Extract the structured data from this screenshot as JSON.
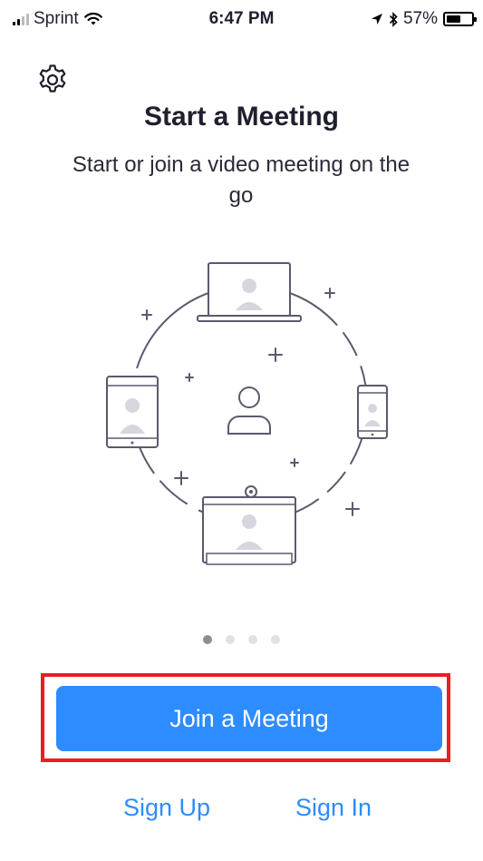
{
  "status_bar": {
    "carrier": "Sprint",
    "time": "6:47 PM",
    "battery": "57%",
    "battery_level": 0.57,
    "icons": [
      "signal-icon",
      "wifi-icon",
      "location-arrow-icon",
      "bluetooth-icon",
      "battery-icon"
    ]
  },
  "header": {
    "settings_icon": "gear-icon"
  },
  "main": {
    "title": "Start a Meeting",
    "subtitle": "Start or join a video meeting on the go",
    "illustration_icons": [
      "laptop-icon",
      "tablet-icon",
      "phone-icon",
      "room-display-icon",
      "user-icon",
      "plus-icon"
    ],
    "page_indicator": {
      "count": 4,
      "active_index": 0
    }
  },
  "actions": {
    "join_label": "Join a Meeting",
    "signup_label": "Sign Up",
    "signin_label": "Sign In"
  },
  "colors": {
    "accent": "#2d8cff",
    "highlight": "#ec1c24",
    "text": "#1f1f2e",
    "illustration_stroke": "#5a5a6e",
    "illustration_fill": "#d6d6de"
  }
}
